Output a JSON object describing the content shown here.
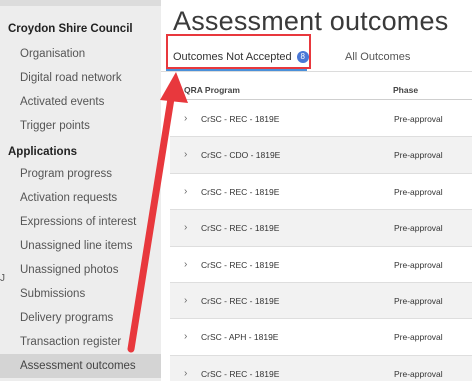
{
  "sidebar": {
    "org_heading": "Croydon Shire Council",
    "org_items": [
      {
        "label": "Organisation"
      },
      {
        "label": "Digital road network"
      },
      {
        "label": "Activated events"
      },
      {
        "label": "Trigger points"
      }
    ],
    "apps_heading": "Applications",
    "app_items": [
      {
        "label": "Program progress"
      },
      {
        "label": "Activation requests"
      },
      {
        "label": "Expressions of interest"
      },
      {
        "label": "Unassigned line items"
      },
      {
        "label": "Unassigned photos"
      },
      {
        "label": "Submissions"
      },
      {
        "label": "Delivery programs"
      },
      {
        "label": "Transaction register"
      },
      {
        "label": "Assessment outcomes",
        "active": true
      }
    ],
    "stray_glyph": "J"
  },
  "page": {
    "title": "Assessment outcomes"
  },
  "tabs": {
    "active_label": "Outcomes Not Accepted",
    "active_badge": "8",
    "other_label": "All Outcomes"
  },
  "table": {
    "columns": [
      "QRA Program",
      "Phase"
    ],
    "rows": [
      {
        "program": "CrSC - REC - 1819E",
        "phase": "Pre-approval"
      },
      {
        "program": "CrSC - CDO - 1819E",
        "phase": "Pre-approval"
      },
      {
        "program": "CrSC - REC - 1819E",
        "phase": "Pre-approval"
      },
      {
        "program": "CrSC - REC - 1819E",
        "phase": "Pre-approval"
      },
      {
        "program": "CrSC - REC - 1819E",
        "phase": "Pre-approval"
      },
      {
        "program": "CrSC - REC - 1819E",
        "phase": "Pre-approval"
      },
      {
        "program": "CrSC - APH - 1819E",
        "phase": "Pre-approval"
      },
      {
        "program": "CrSC - REC - 1819E",
        "phase": "Pre-approval"
      }
    ]
  },
  "annotation": {
    "color": "#e8383d"
  },
  "icons": {
    "row_expand": "chevron-right-icon",
    "chevron_glyph": "›"
  }
}
